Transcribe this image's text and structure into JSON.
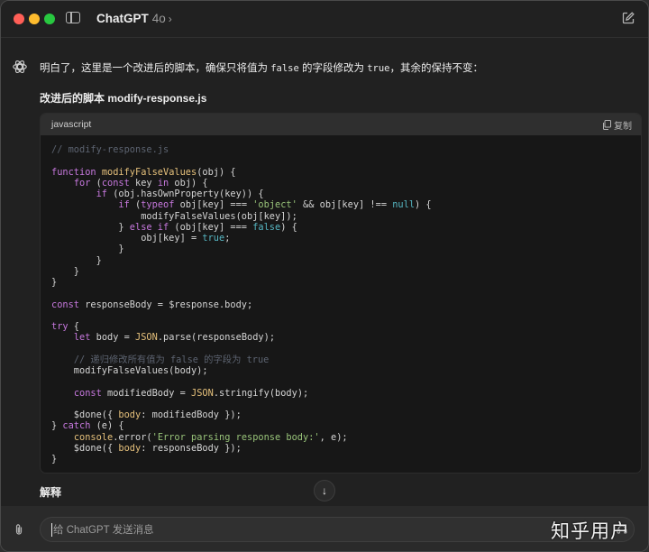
{
  "window": {
    "app_title": "ChatGPT",
    "model": "4o",
    "chevron": "›",
    "icons": [
      "sidebar-toggle-icon",
      "new-chat-icon"
    ]
  },
  "message": {
    "intro_parts": [
      "明白了，这里是一个改进后的脚本，确保只将值为 ",
      "false",
      " 的字段修改为 ",
      "true",
      "，其余的保持不变："
    ],
    "heading": "改进后的脚本 modify-response.js"
  },
  "code_block": {
    "language": "javascript",
    "copy_label": "复制",
    "lines": [
      [
        [
          "c",
          "// modify-response.js"
        ]
      ],
      [],
      [
        [
          "k",
          "function"
        ],
        [
          "p",
          " "
        ],
        [
          "f",
          "modifyFalseValues"
        ],
        [
          "p",
          "(obj) {"
        ]
      ],
      [
        [
          "p",
          "    "
        ],
        [
          "k",
          "for"
        ],
        [
          "p",
          " ("
        ],
        [
          "k",
          "const"
        ],
        [
          "p",
          " key "
        ],
        [
          "k",
          "in"
        ],
        [
          "p",
          " obj) {"
        ]
      ],
      [
        [
          "p",
          "        "
        ],
        [
          "k",
          "if"
        ],
        [
          "p",
          " (obj.hasOwnProperty(key)) {"
        ]
      ],
      [
        [
          "p",
          "            "
        ],
        [
          "k",
          "if"
        ],
        [
          "p",
          " ("
        ],
        [
          "k",
          "typeof"
        ],
        [
          "p",
          " obj[key] === "
        ],
        [
          "s",
          "'object'"
        ],
        [
          "p",
          " && obj[key] !== "
        ],
        [
          "n",
          "null"
        ],
        [
          "p",
          ") {"
        ]
      ],
      [
        [
          "p",
          "                modifyFalseValues(obj[key]);"
        ]
      ],
      [
        [
          "p",
          "            } "
        ],
        [
          "k",
          "else if"
        ],
        [
          "p",
          " (obj[key] === "
        ],
        [
          "n",
          "false"
        ],
        [
          "p",
          ") {"
        ]
      ],
      [
        [
          "p",
          "                obj[key] = "
        ],
        [
          "n",
          "true"
        ],
        [
          "p",
          ";"
        ]
      ],
      [
        [
          "p",
          "            }"
        ]
      ],
      [
        [
          "p",
          "        }"
        ]
      ],
      [
        [
          "p",
          "    }"
        ]
      ],
      [
        [
          "p",
          "}"
        ]
      ],
      [],
      [
        [
          "k",
          "const"
        ],
        [
          "p",
          " responseBody = $response.body;"
        ]
      ],
      [],
      [
        [
          "k",
          "try"
        ],
        [
          "p",
          " {"
        ]
      ],
      [
        [
          "p",
          "    "
        ],
        [
          "k",
          "let"
        ],
        [
          "p",
          " body = "
        ],
        [
          "ob",
          "JSON"
        ],
        [
          "p",
          ".parse(responseBody);"
        ]
      ],
      [],
      [
        [
          "p",
          "    "
        ],
        [
          "c",
          "// 递归修改所有值为 false 的字段为 true"
        ]
      ],
      [
        [
          "p",
          "    modifyFalseValues(body);"
        ]
      ],
      [],
      [
        [
          "p",
          "    "
        ],
        [
          "k",
          "const"
        ],
        [
          "p",
          " modifiedBody = "
        ],
        [
          "ob",
          "JSON"
        ],
        [
          "p",
          ".stringify(body);"
        ]
      ],
      [],
      [
        [
          "p",
          "    $done({ "
        ],
        [
          "ob",
          "body"
        ],
        [
          "p",
          ": modifiedBody });"
        ]
      ],
      [
        [
          "p",
          "} "
        ],
        [
          "k",
          "catch"
        ],
        [
          "p",
          " (e) {"
        ]
      ],
      [
        [
          "p",
          "    "
        ],
        [
          "ob",
          "console"
        ],
        [
          "p",
          ".error("
        ],
        [
          "s",
          "'Error parsing response body:'"
        ],
        [
          "p",
          ", e);"
        ]
      ],
      [
        [
          "p",
          "    $done({ "
        ],
        [
          "ob",
          "body"
        ],
        [
          "p",
          ": responseBody });"
        ]
      ],
      [
        [
          "p",
          "}"
        ]
      ]
    ]
  },
  "explanation_heading": "解释",
  "scroll_down_glyph": "↓",
  "composer": {
    "placeholder": "给 ChatGPT 发送消息"
  },
  "watermark": "知乎用户",
  "colors": {
    "background": "#212121",
    "code_background": "#171717",
    "keyword": "#c678dd",
    "function": "#e5c07b",
    "string": "#98c379",
    "literal": "#56b6c2",
    "comment": "#5c6370"
  }
}
